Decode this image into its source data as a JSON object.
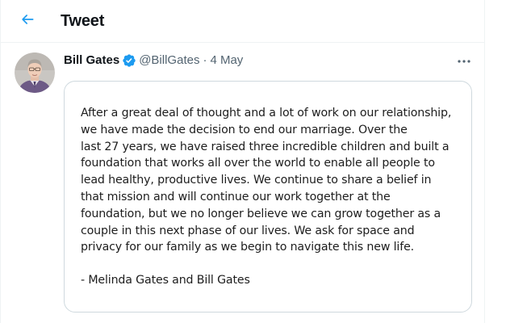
{
  "header": {
    "title": "Tweet",
    "back_icon": "arrow-left-icon",
    "accent_color": "#1d9bf0"
  },
  "tweet": {
    "author_name": "Bill Gates",
    "handle": "@BillGates",
    "separator": "·",
    "date": "4 May",
    "verified": true,
    "verified_icon": "verified-badge-icon",
    "more_icon": "more-horizontal-icon",
    "image_text": {
      "lines": [
        "After a great deal of thought and a lot of work on our relationship,",
        "we have made the decision to end our marriage. Over the",
        "last 27 years, we have raised three incredible children and built a",
        "foundation that works all over the world to enable all people to",
        "lead healthy, productive lives. We continue to share a belief in",
        "that mission and will continue our work together at the",
        "foundation, but we no longer believe we can grow together as a",
        "couple in this next phase of our lives. We ask for space and",
        "privacy for our family as we begin to navigate this new life."
      ],
      "signature": "- Melinda Gates and Bill Gates"
    }
  }
}
